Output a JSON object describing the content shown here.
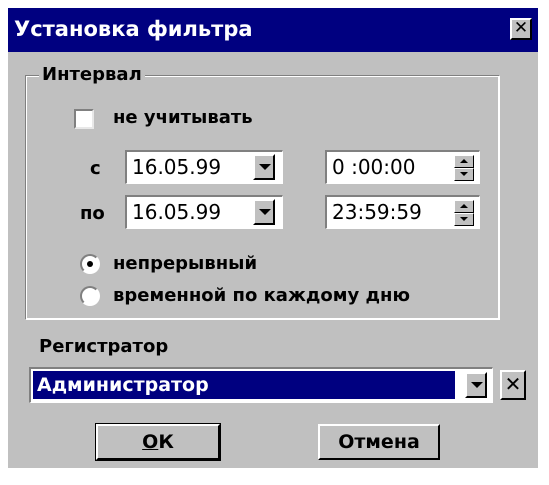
{
  "window": {
    "title": "Установка фильтра",
    "close_label": "✕"
  },
  "interval": {
    "legend": "Интервал",
    "ignore_label": "не учитывать",
    "ignore_checked": false,
    "from_label": "с",
    "to_label": "по",
    "from_date": "16.05.99",
    "from_time": "0 :00:00",
    "to_date": "16.05.99",
    "to_time": "23:59:59",
    "mode_continuous": "непрерывный",
    "mode_daily": "временной по каждому дню",
    "selected_mode": "непрерывный"
  },
  "registrar": {
    "label": "Регистратор",
    "value": "Администратор",
    "clear_label": "✕"
  },
  "buttons": {
    "ok_accel": "О",
    "ok_rest": "К",
    "cancel": "Отмена"
  },
  "icons": {
    "dropdown": "chevron-down-icon",
    "spin": "spinner-arrows-icon",
    "close": "close-icon"
  }
}
